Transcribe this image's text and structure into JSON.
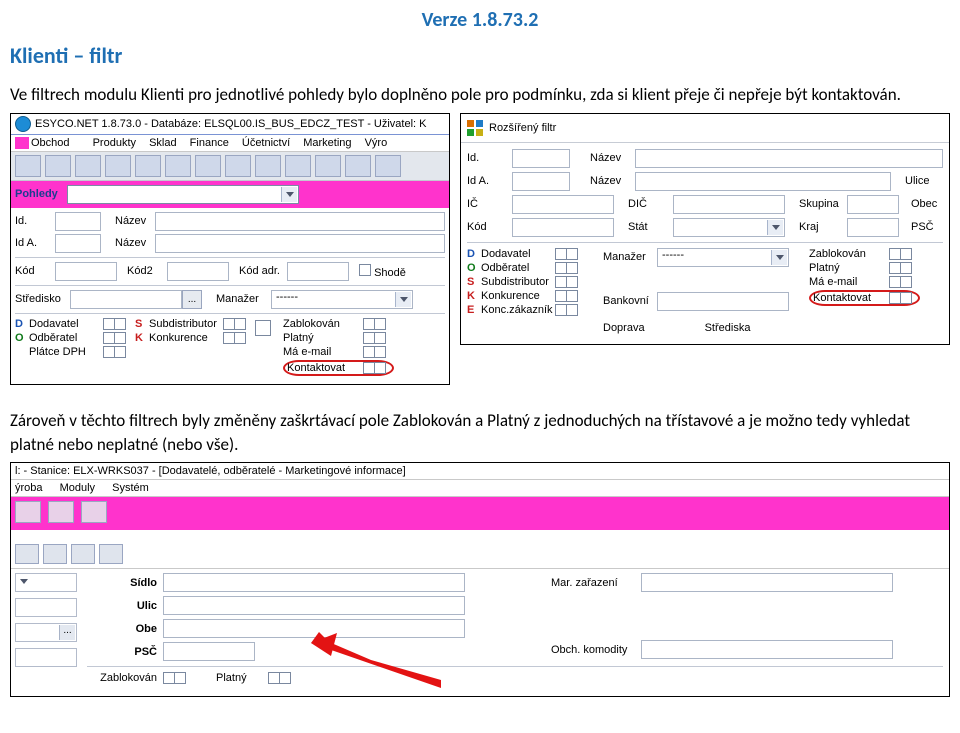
{
  "doc": {
    "version": "Verze 1.8.73.2",
    "heading": "Klienti – filtr",
    "p1": "Ve  filtrech modulu Klienti pro jednotlivé pohledy bylo doplněno pole pro podmínku, zda si klient přeje či nepřeje být kontaktován.",
    "p2": "Zároveň v těchto filtrech byly změněny zaškrtávací pole Zablokován a Platný z jednoduchých na třístavové a je možno tedy vyhledat platné nebo neplatné (nebo vše)."
  },
  "shot1": {
    "title": "ESYCO.NET 1.8.73.0 - Databáze: ELSQL00.IS_BUS_EDCZ_TEST - Uživatel: K",
    "menu": {
      "obchod": "Obchod",
      "produkty": "Produkty",
      "sklad": "Sklad",
      "finance": "Finance",
      "ucetnictvi": "Účetnictví",
      "marketing": "Marketing",
      "vyro": "Výro"
    },
    "pohledy_lbl": "Pohledy",
    "labels": {
      "id": "Id.",
      "nazev": "Název",
      "ida": "Id A.",
      "kod": "Kód",
      "kod2": "Kód2",
      "kodadr": "Kód adr.",
      "shoda": "Shodě",
      "stredisko": "Středisko",
      "manazer": "Manažer",
      "manazer_val": "------"
    },
    "flags_left": [
      {
        "letter": "D",
        "name": "Dodavatel"
      },
      {
        "letter": "O",
        "name": "Odběratel"
      },
      {
        "letter": "",
        "name": "Plátce DPH"
      }
    ],
    "flags_left2": [
      {
        "letter": "S",
        "name": "Subdistributor"
      },
      {
        "letter": "K",
        "name": "Konkurence"
      }
    ],
    "right_flags": [
      {
        "name": "Zablokován"
      },
      {
        "name": "Platný"
      },
      {
        "name": "Má e-mail"
      },
      {
        "name": "Kontaktovat",
        "hl": true
      }
    ]
  },
  "rf": {
    "title": "Rozšířený filtr",
    "labels": {
      "id": "Id.",
      "nazev": "Název",
      "ida": "Id A.",
      "ulice": "Ulice",
      "ic": "IČ",
      "dic": "DIČ",
      "skupina": "Skupina",
      "obec": "Obec",
      "kod": "Kód",
      "stat": "Stát",
      "kraj": "Kraj",
      "psc": "PSČ",
      "manazer": "Manažer",
      "manazer_val": "------",
      "bankovni": "Bankovní",
      "doprava": "Doprava",
      "strediska": "Střediska"
    },
    "flags_left": [
      {
        "letter": "D",
        "name": "Dodavatel"
      },
      {
        "letter": "O",
        "name": "Odběratel"
      },
      {
        "letter": "S",
        "name": "Subdistributor"
      },
      {
        "letter": "K",
        "name": "Konkurence"
      },
      {
        "letter": "E",
        "name": "Konc.zákazník"
      }
    ],
    "right_flags": [
      {
        "name": "Zablokován"
      },
      {
        "name": "Platný"
      },
      {
        "name": "Má e-mail"
      },
      {
        "name": "Kontaktovat",
        "hl": true
      }
    ]
  },
  "shot2": {
    "title": "l:              - Stanice: ELX-WRKS037 - [Dodavatelé, odběratelé - Marketingové informace]",
    "menu": {
      "yroba": "ýroba",
      "moduly": "Moduly",
      "system": "Systém"
    },
    "labels": {
      "sidlo": "Sídlo",
      "ulic": "Ulic",
      "obe": "Obe",
      "psc": "PSČ",
      "zab": "Zablokován",
      "platny": "Platný",
      "mar": "Mar. zařazení",
      "kom": "Obch. komodity"
    }
  }
}
